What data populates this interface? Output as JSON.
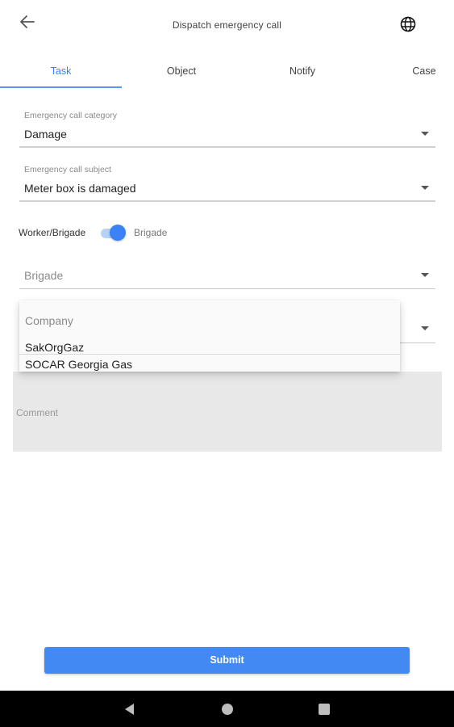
{
  "header": {
    "title": "Dispatch emergency call",
    "back_icon": "arrow-left-icon",
    "language_icon": "globe-icon"
  },
  "tabs": [
    {
      "label": "Task",
      "active": true
    },
    {
      "label": "Object",
      "active": false
    },
    {
      "label": "Notify",
      "active": false
    },
    {
      "label": "Case",
      "active": false
    }
  ],
  "form": {
    "category": {
      "label": "Emergency call category",
      "value": "Damage"
    },
    "subject": {
      "label": "Emergency call subject",
      "value": "Meter box is damaged"
    },
    "toggle": {
      "left_label": "Worker/Brigade",
      "right_label": "Brigade",
      "on": true
    },
    "brigade": {
      "placeholder": "Brigade"
    },
    "comment": {
      "placeholder": "Comment"
    }
  },
  "company_dropdown": {
    "label": "Company",
    "options": [
      "SakOrgGaz",
      "SOCAR Georgia Gas"
    ]
  },
  "submit_label": "Submit",
  "colors": {
    "accent": "#3b82f6",
    "button": "#4289f4"
  }
}
